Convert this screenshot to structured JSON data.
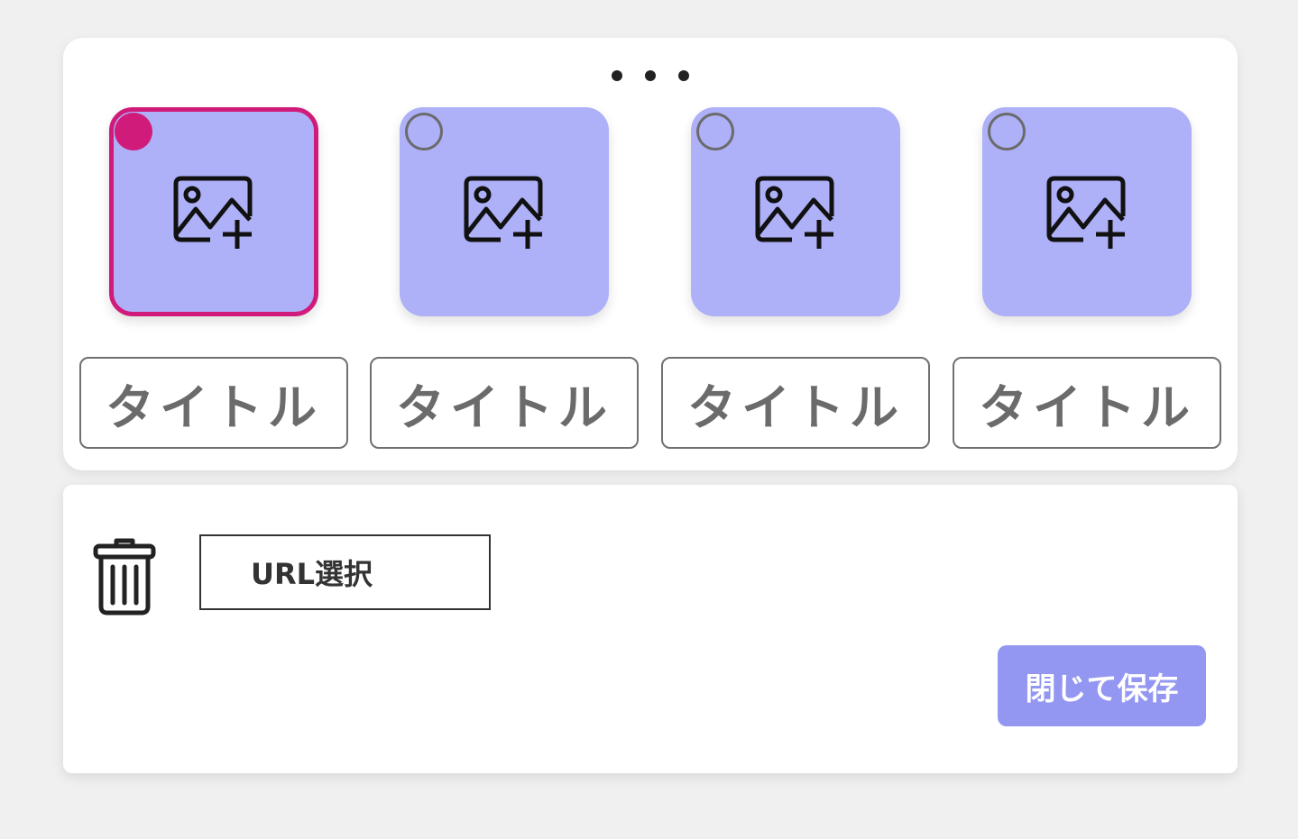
{
  "colors": {
    "tile_fill": "#aeb0f8",
    "selected_accent": "#d11b7a",
    "save_button": "#9397f2"
  },
  "more_menu": {
    "icon": "more-horizontal-icon"
  },
  "image_slots": [
    {
      "selected": true,
      "icon": "add-image-icon",
      "title": "タイトル"
    },
    {
      "selected": false,
      "icon": "add-image-icon",
      "title": "タイトル"
    },
    {
      "selected": false,
      "icon": "add-image-icon",
      "title": "タイトル"
    },
    {
      "selected": false,
      "icon": "add-image-icon",
      "title": "タイトル"
    }
  ],
  "actions": {
    "delete_icon": "trash-icon",
    "url_select_label": "URL選択",
    "save_close_label": "閉じて保存"
  }
}
